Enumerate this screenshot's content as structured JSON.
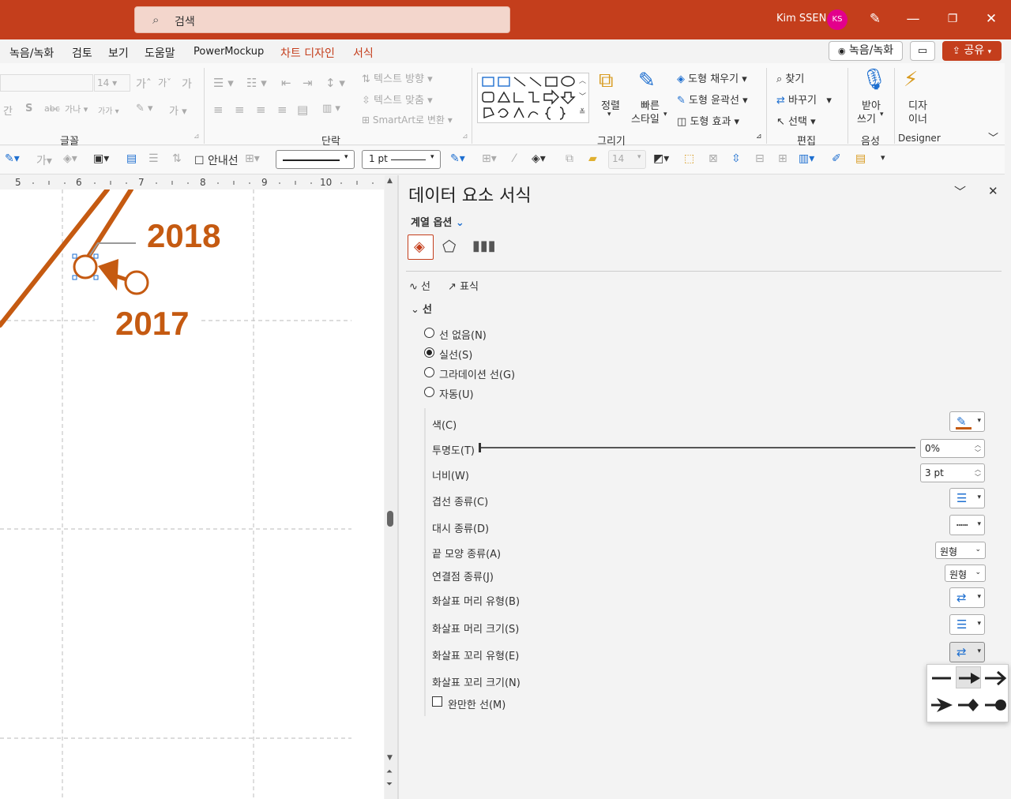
{
  "titlebar": {
    "search_placeholder": "검색",
    "user_name": "Kim SSEN",
    "avatar_initials": "KS",
    "accent_color": "#c43e1c"
  },
  "menu": {
    "items": [
      "녹음/녹화",
      "검토",
      "보기",
      "도움말",
      "PowerMockup",
      "차트 디자인",
      "서식"
    ],
    "record_button": "녹음/녹화",
    "share_button": "공유"
  },
  "ribbon": {
    "font_size": "14",
    "group_font": "글꼴",
    "group_paragraph": "단락",
    "group_drawing": "그리기",
    "group_edit": "편집",
    "group_voice": "음성",
    "group_designer": "Designer",
    "text_direction": "텍스트 방향",
    "text_align": "텍스트 맞춤",
    "smartart": "SmartArt로 변환",
    "arrange": "정렬",
    "quick_styles_1": "빠른",
    "quick_styles_2": "스타일",
    "shape_fill": "도형 채우기",
    "shape_outline": "도형 윤곽선",
    "shape_effects": "도형 효과",
    "find": "찾기",
    "replace": "바꾸기",
    "select": "선택",
    "dictate_1": "받아",
    "dictate_2": "쓰기",
    "designer_1": "디자",
    "designer_2": "이너"
  },
  "toolbar2": {
    "guides": "안내선",
    "line_weight": "1 pt",
    "font_size": "14"
  },
  "ruler": [
    "5",
    "6",
    "7",
    "8",
    "9",
    "10"
  ],
  "slide": {
    "label_2018": "2018",
    "label_2017": "2017",
    "line_color": "#c55a11"
  },
  "pane": {
    "title": "데이터 요소 서식",
    "series_options": "계열 옵션",
    "tab_line": "선",
    "tab_marker": "표식",
    "section_line": "선",
    "radio_no_line": "선 없음(N)",
    "radio_solid": "실선(S)",
    "radio_gradient": "그라데이션 선(G)",
    "radio_auto": "자동(U)",
    "color": "색(C)",
    "transparency": "투명도(T)",
    "transparency_value": "0%",
    "width": "너비(W)",
    "width_value": "3 pt",
    "compound": "겹선 종류(C)",
    "dash": "대시 종류(D)",
    "cap": "끝 모양 종류(A)",
    "cap_value": "원형",
    "join": "연결점 종류(J)",
    "join_value": "원형",
    "begin_type": "화살표 머리 유형(B)",
    "begin_size": "화살표 머리 크기(S)",
    "end_type": "화살표 꼬리 유형(E)",
    "end_size": "화살표 꼬리 크기(N)",
    "smooth": "완만한 선(M)"
  }
}
